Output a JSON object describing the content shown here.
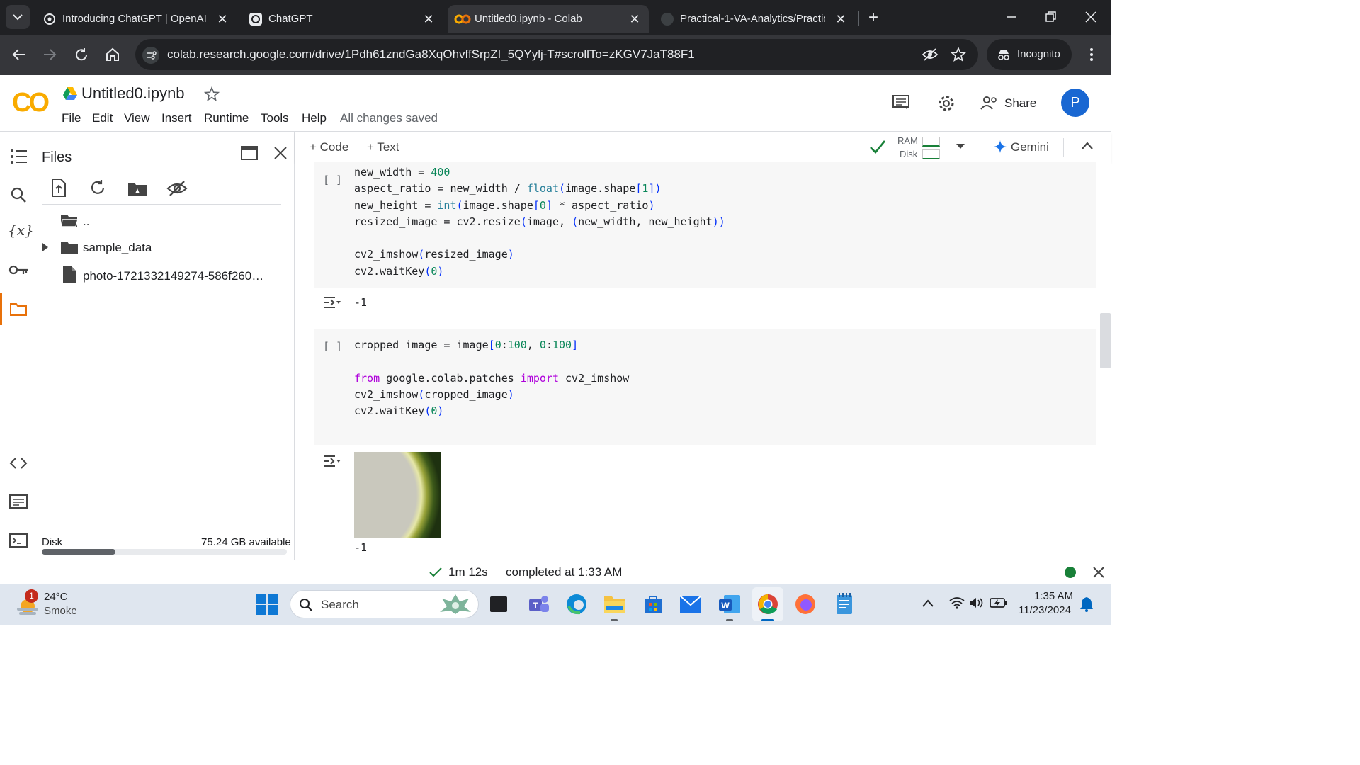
{
  "browser": {
    "tabs": [
      {
        "title": "Introducing ChatGPT | OpenAI",
        "active": false
      },
      {
        "title": "ChatGPT",
        "active": false
      },
      {
        "title": "Untitled0.ipynb - Colab",
        "active": true
      },
      {
        "title": "Practical-1-VA-Analytics/Practic",
        "active": false
      }
    ],
    "url": "colab.research.google.com/drive/1Pdh61zndGa8XqOhvffSrpZI_5QYylj-T#scrollTo=zKGV7JaT88F1",
    "incognito_label": "Incognito"
  },
  "colab": {
    "logo": "CO",
    "notebook_name": "Untitled0.ipynb",
    "menu": [
      "File",
      "Edit",
      "View",
      "Insert",
      "Runtime",
      "Tools",
      "Help"
    ],
    "save_status": "All changes saved",
    "share_label": "Share",
    "avatar_letter": "P",
    "toolbar": {
      "code": "Code",
      "text": "Text",
      "ram": "RAM",
      "disk": "Disk",
      "gemini": "Gemini"
    }
  },
  "files_panel": {
    "title": "Files",
    "items": [
      {
        "name": "..",
        "type": "folder"
      },
      {
        "name": "sample_data",
        "type": "folder"
      },
      {
        "name": "photo-1721332149274-586f260…",
        "type": "file"
      }
    ],
    "disk_label": "Disk",
    "disk_available": "75.24 GB available",
    "disk_used_fraction": 0.3
  },
  "cells": [
    {
      "bracket": "[ ]",
      "lines": [
        "new_width = 400",
        "aspect_ratio = new_width / float(image.shape[1])",
        "new_height = int(image.shape[0] * aspect_ratio)",
        "resized_image = cv2.resize(image, (new_width, new_height))",
        "",
        "cv2_imshow(resized_image)",
        "cv2.waitKey(0)"
      ],
      "output": "-1"
    },
    {
      "bracket": "[ ]",
      "lines": [
        "cropped_image = image[0:100, 0:100]",
        "",
        "from google.colab.patches import cv2_imshow",
        "cv2_imshow(cropped_image)",
        "cv2.waitKey(0)"
      ],
      "output": "-1"
    }
  ],
  "status": {
    "duration": "1m 12s",
    "completed": "completed at 1:33 AM"
  },
  "taskbar": {
    "weather_temp": "24°C",
    "weather_desc": "Smoke",
    "weather_badge": "1",
    "search_placeholder": "Search",
    "time": "1:35 AM",
    "date": "11/23/2024"
  }
}
